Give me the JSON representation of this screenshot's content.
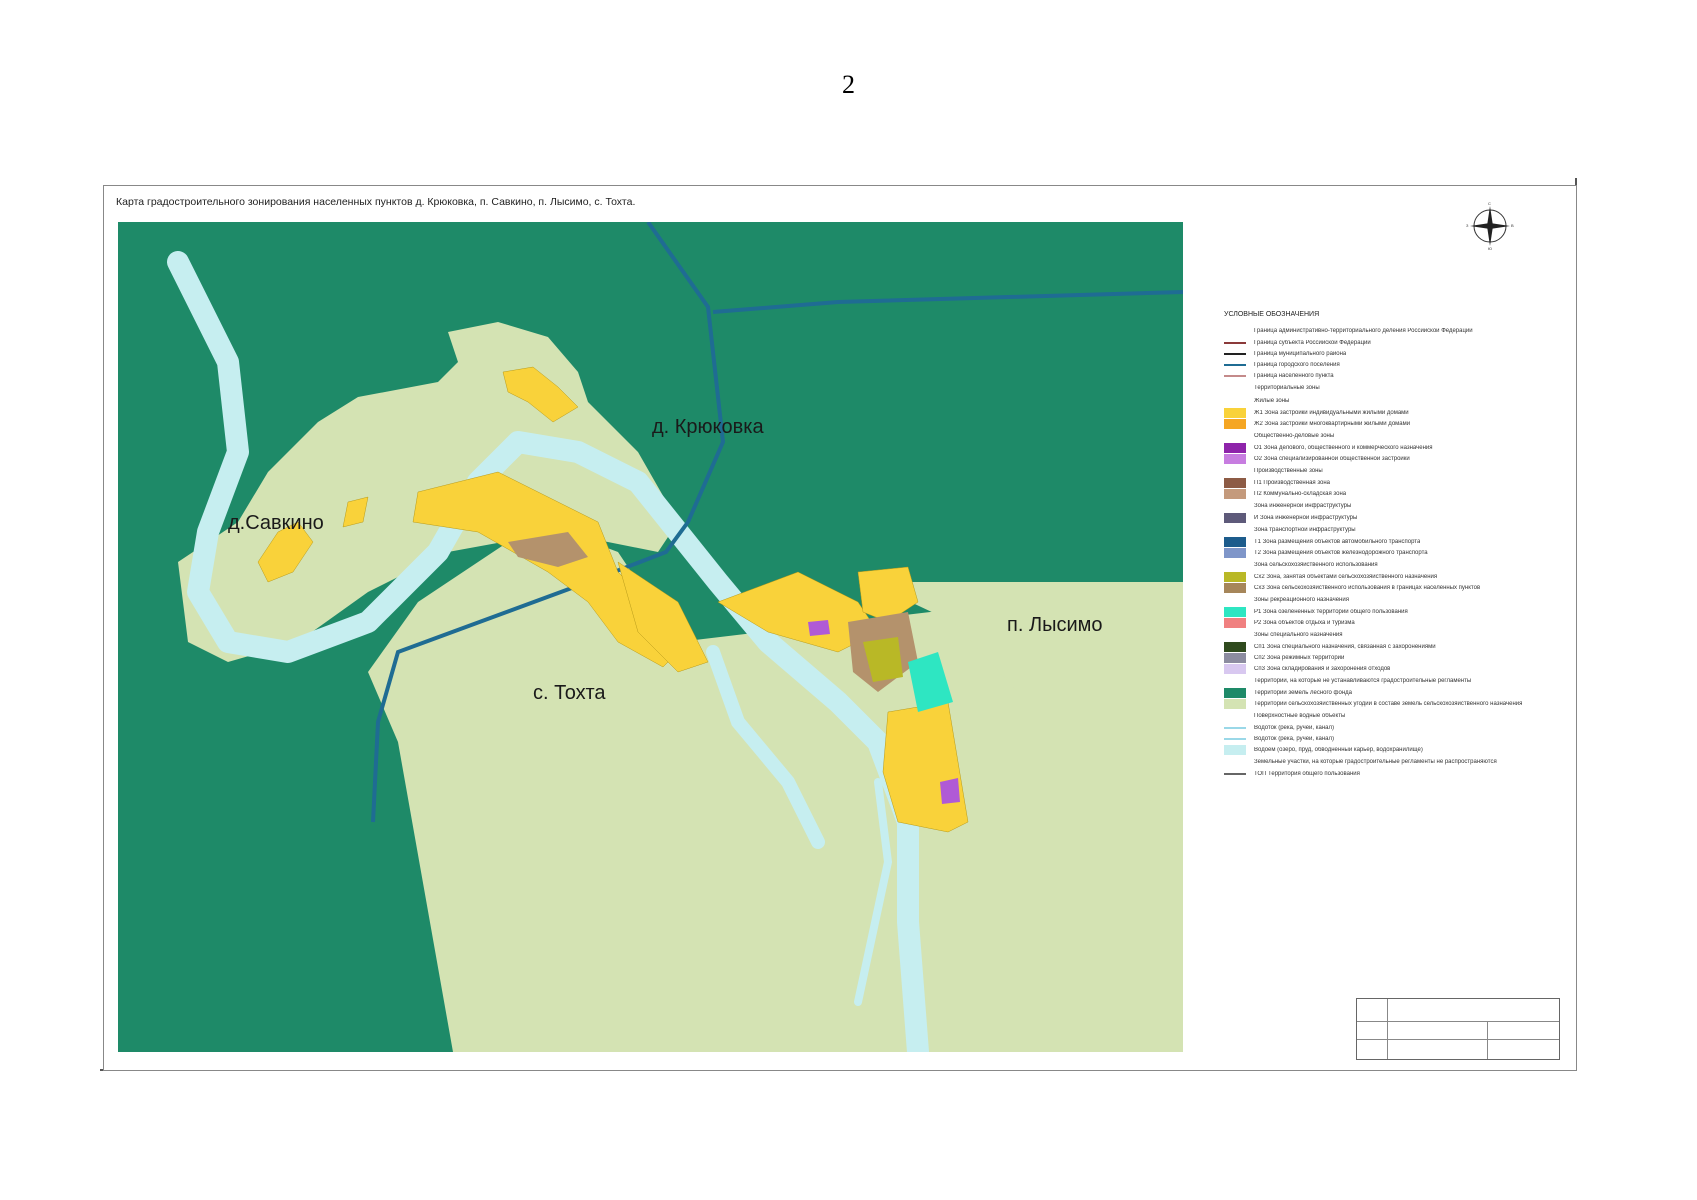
{
  "page_number": "2",
  "map": {
    "title": "Карта градостроительного зонирования населенных пунктов д. Крюковка, п. Савкино, п. Лысимо, с. Тохта.",
    "places": [
      "д. Крюковка",
      "д.Савкино",
      "п. Лысимо",
      "с. Тохта"
    ],
    "colors": {
      "forest": "#1e8a68",
      "agricultural": "#d4e3b3",
      "river": "#c6eef0",
      "residential": "#f9d23a",
      "production": "#b4926c",
      "agri_objects": "#b9b826",
      "recreation": "#2ee6c2",
      "public_business": "#b05ad6",
      "boundary": "#1f6c93"
    }
  },
  "compass": {
    "n": "С",
    "s": "Ю",
    "w": "З",
    "e": "В"
  },
  "legend": {
    "heading": "УСЛОВНЫЕ ОБОЗНАЧЕНИЯ",
    "items": [
      {
        "text": "Граница административно-территориального деления Российской Федерации",
        "kind": "text"
      },
      {
        "text": "Граница субъекта Российской Федерации",
        "kind": "line",
        "color": "#8b3a3a"
      },
      {
        "text": "Граница муниципального района",
        "kind": "line",
        "color": "#222222"
      },
      {
        "text": "Граница городского поселения",
        "kind": "line",
        "color": "#1f6c93"
      },
      {
        "text": "Граница населенного пункта",
        "kind": "line",
        "color": "#c48a8a"
      },
      {
        "text": "Территориальные зоны",
        "kind": "text"
      },
      {
        "text": "Жилые зоны",
        "kind": "text"
      },
      {
        "text": "Ж1 Зона застройки индивидуальными жилыми домами",
        "kind": "swatch",
        "color": "#f9d23a"
      },
      {
        "text": "Ж2 Зона застройки многоквартирными жилыми домами",
        "kind": "swatch",
        "color": "#f5a623"
      },
      {
        "text": "Общественно-деловые зоны",
        "kind": "text"
      },
      {
        "text": "О1 Зона делового, общественного и коммерческого назначения",
        "kind": "swatch",
        "color": "#8e24aa"
      },
      {
        "text": "О2 Зона специализированной общественной застройки",
        "kind": "swatch",
        "color": "#c77de0"
      },
      {
        "text": "Производственные зоны",
        "kind": "text"
      },
      {
        "text": "П1 Производственная зона",
        "kind": "swatch",
        "color": "#8d5b45"
      },
      {
        "text": "П2 Коммунально-складская зона",
        "kind": "swatch",
        "color": "#c49a7c"
      },
      {
        "text": "Зона инженерной инфраструктуры",
        "kind": "text"
      },
      {
        "text": "И Зона инженерной инфраструктуры",
        "kind": "swatch",
        "color": "#5e5a7a"
      },
      {
        "text": "Зона транспортной инфраструктуры",
        "kind": "text"
      },
      {
        "text": "Т1 Зона размещения объектов автомобильного транспорта",
        "kind": "swatch",
        "color": "#1d5c8c"
      },
      {
        "text": "Т2 Зона размещения объектов железнодорожного транспорта",
        "kind": "swatch",
        "color": "#7f96c9"
      },
      {
        "text": "Зона сельскохозяйственного использования",
        "kind": "text"
      },
      {
        "text": "Сх2 Зона, занятая объектами сельскохозяйственного назначения",
        "kind": "swatch",
        "color": "#b9b826"
      },
      {
        "text": "Сх3 Зона сельскохозяйственного использования в границах населенных пунктов",
        "kind": "swatch",
        "color": "#a6865a"
      },
      {
        "text": "Зоны рекреационного назначения",
        "kind": "text"
      },
      {
        "text": "Р1 Зона озелененных территорий общего пользования",
        "kind": "swatch",
        "color": "#2ee6c2"
      },
      {
        "text": "Р2 Зона объектов отдыха и туризма",
        "kind": "swatch",
        "color": "#f08080"
      },
      {
        "text": "Зоны специального назначения",
        "kind": "text"
      },
      {
        "text": "Сп1 Зона специального назначения, связанная с захоронениями",
        "kind": "swatch",
        "color": "#2f4a1e"
      },
      {
        "text": "Сп2 Зона режимных территорий",
        "kind": "swatch",
        "color": "#8c8ca0"
      },
      {
        "text": "Сп3 Зона складирования и захоронения отходов",
        "kind": "swatch",
        "color": "#d8c8f0"
      },
      {
        "text": "Территории, на которые не устанавливаются градостроительные регламенты",
        "kind": "text"
      },
      {
        "text": "Территории земель лесного фонда",
        "kind": "swatch",
        "color": "#1e8a68"
      },
      {
        "text": "Территории сельскохозяйственных угодий в составе земель сельскохозяйственного назначения",
        "kind": "swatch",
        "color": "#d4e3b3"
      },
      {
        "text": "Поверхностные водные объекты",
        "kind": "text"
      },
      {
        "text": "Водоток (река, ручей, канал)",
        "kind": "line",
        "color": "#9ad8e8"
      },
      {
        "text": "Водоток (река, ручей, канал)",
        "kind": "line",
        "color": "#9ad8e8"
      },
      {
        "text": "Водоем (озеро, пруд, обводненный карьер, водохранилище)",
        "kind": "swatch",
        "color": "#c6eef0"
      },
      {
        "text": "Земельные участки, на которые градостроительные регламенты не распространяются",
        "kind": "text"
      },
      {
        "text": "ТОП Территория общего пользования",
        "kind": "line",
        "color": "#666666"
      }
    ]
  }
}
